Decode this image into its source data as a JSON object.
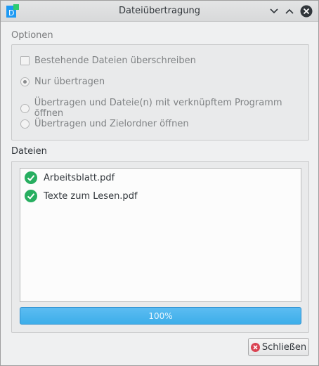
{
  "window": {
    "title": "Dateiübertragung",
    "app_icon": "file-transfer-app-icon",
    "controls": {
      "minimize_icon": "chevron-down-icon",
      "maximize_icon": "chevron-up-icon",
      "close_icon": "close-circle-icon"
    }
  },
  "options": {
    "heading": "Optionen",
    "overwrite_checkbox": {
      "label": "Bestehende Dateien überschreiben",
      "checked": false,
      "enabled": false
    },
    "radios": [
      {
        "label": "Nur übertragen",
        "checked": true
      },
      {
        "label": "Übertragen und Dateie(n) mit verknüpftem Programm öffnen",
        "checked": false
      },
      {
        "label": "Übertragen und Zielordner öffnen",
        "checked": false
      }
    ]
  },
  "files": {
    "heading": "Dateien",
    "items": [
      {
        "name": "Arbeitsblatt.pdf",
        "status_icon": "check-circle-icon"
      },
      {
        "name": "Texte zum Lesen.pdf",
        "status_icon": "check-circle-icon"
      }
    ],
    "progress": {
      "value": 1.0,
      "label": "100%"
    }
  },
  "footer": {
    "close_label": "Schließen",
    "close_icon": "cancel-icon"
  },
  "colors": {
    "accent": "#3daee9",
    "success": "#27ae60",
    "close_red": "#da4453"
  }
}
